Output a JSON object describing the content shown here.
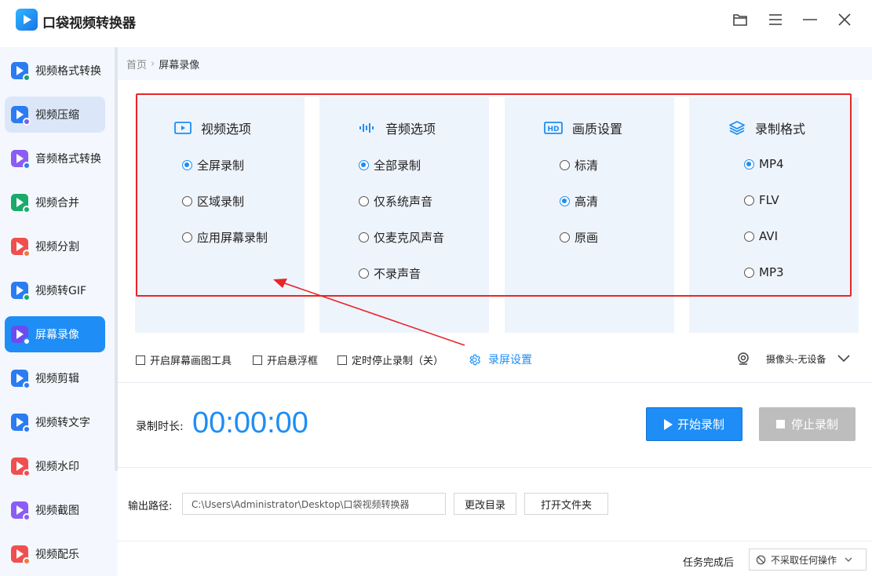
{
  "app": {
    "title": "口袋视频转换器"
  },
  "colors": {
    "accent": "#1e8df5",
    "highlight_box": "#e8262a",
    "sidebar_bg": "#f4f8fe"
  },
  "window_controls": [
    "folder-icon",
    "menu-icon",
    "minimize-icon",
    "close-icon"
  ],
  "sidebar": {
    "items": [
      {
        "label": "视频格式转换",
        "icon": "video-convert-icon",
        "color": "#2b7cf2",
        "badge": "#1aa06b"
      },
      {
        "label": "视频压缩",
        "icon": "video-compress-icon",
        "color": "#2b7cf2",
        "badge": "#7a5cf0"
      },
      {
        "label": "音频格式转换",
        "icon": "audio-convert-icon",
        "color": "#8b5cf6",
        "badge": "#2b7cf2"
      },
      {
        "label": "视频合并",
        "icon": "video-merge-icon",
        "color": "#1aaa6b",
        "badge": "#1aaa6b"
      },
      {
        "label": "视频分割",
        "icon": "video-split-icon",
        "color": "#f04f4f",
        "badge": "#f07a3a"
      },
      {
        "label": "视频转GIF",
        "icon": "video-gif-icon",
        "color": "#2b7cf2",
        "badge": "#1aaa6b"
      },
      {
        "label": "屏幕录像",
        "icon": "screen-record-icon",
        "color": "#6a4cf0",
        "badge": "#ffffff"
      },
      {
        "label": "视频剪辑",
        "icon": "video-edit-icon",
        "color": "#2b7cf2",
        "badge": "#2b7cf2"
      },
      {
        "label": "视频转文字",
        "icon": "video-text-icon",
        "color": "#2b7cf2",
        "badge": "#2b7cf2"
      },
      {
        "label": "视频水印",
        "icon": "video-watermark-icon",
        "color": "#f04f4f",
        "badge": "#f04f4f"
      },
      {
        "label": "视频截图",
        "icon": "video-screenshot-icon",
        "color": "#8b5cf6",
        "badge": "#8b5cf6"
      },
      {
        "label": "视频配乐",
        "icon": "video-music-icon",
        "color": "#f04f4f",
        "badge": "#f07a3a"
      }
    ],
    "active_index": 6,
    "hover_index": 1
  },
  "breadcrumb": {
    "home": "首页",
    "separator": "›",
    "current": "屏幕录像"
  },
  "options": {
    "video": {
      "title": "视频选项",
      "items": [
        "全屏录制",
        "区域录制",
        "应用屏幕录制"
      ],
      "selected": 0
    },
    "audio": {
      "title": "音频选项",
      "items": [
        "全部录制",
        "仅系统声音",
        "仅麦克风声音",
        "不录声音"
      ],
      "selected": 0
    },
    "quality": {
      "title": "画质设置",
      "items": [
        "标清",
        "高清",
        "原画"
      ],
      "selected": 1
    },
    "format": {
      "title": "录制格式",
      "items": [
        "MP4",
        "FLV",
        "AVI",
        "MP3"
      ],
      "selected": 0
    }
  },
  "settings": {
    "draw_tool": "开启屏幕画图工具",
    "float_box": "开启悬浮框",
    "timed_stop": "定时停止录制（关）",
    "record_settings": "录屏设置",
    "camera": "摄像头-无设备"
  },
  "recording": {
    "duration_label": "录制时长:",
    "duration_value": "00:00:00",
    "start_label": "开始录制",
    "stop_label": "停止录制"
  },
  "output": {
    "label": "输出路径:",
    "path": "C:\\Users\\Administrator\\Desktop\\口袋视频转换器",
    "change_dir": "更改目录",
    "open_folder": "打开文件夹"
  },
  "footer": {
    "after_label": "任务完成后",
    "after_value": "不采取任何操作"
  }
}
